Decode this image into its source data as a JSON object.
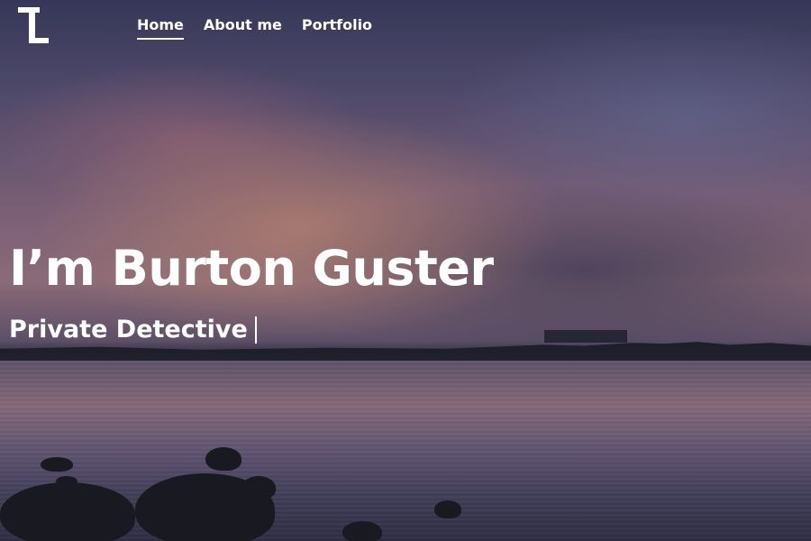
{
  "nav": {
    "logo_icon": "tl-monogram-logo",
    "items": [
      {
        "label": "Home",
        "active": true
      },
      {
        "label": "About me",
        "active": false
      },
      {
        "label": "Portfolio",
        "active": false
      }
    ]
  },
  "hero": {
    "headline": "I’m Burton Guster",
    "subtitle": "Private Detective",
    "text_color": "#ffffff"
  }
}
